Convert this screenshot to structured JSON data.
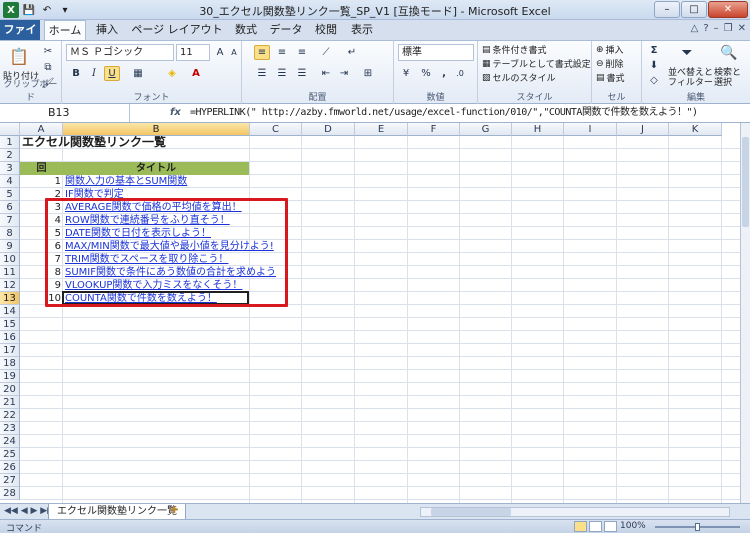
{
  "window": {
    "title": "30_エクセル関数塾リンク一覧_SP_V1 [互換モード] - Microsoft Excel",
    "minimize": "–",
    "maximize": "□",
    "close": "✕"
  },
  "qat": {
    "logo": "X",
    "save": "💾",
    "undo": "↶",
    "dropdown": "▾"
  },
  "tabs": [
    "ファイル",
    "ホーム",
    "挿入",
    "ページ レイアウト",
    "数式",
    "データ",
    "校閲",
    "表示"
  ],
  "tab_right": {
    "help": "?",
    "min": "–",
    "restore": "❐",
    "close": "✕",
    "collapse": "△"
  },
  "ribbon": {
    "clipboard": {
      "paste": "貼り付け",
      "label": "クリップボード"
    },
    "font": {
      "name": "ＭＳ Ｐゴシック",
      "size": "11",
      "bold": "B",
      "italic": "I",
      "underline": "U",
      "label": "フォント"
    },
    "alignment": {
      "label": "配置"
    },
    "number": {
      "format": "標準",
      "percent": "%",
      "comma": ",",
      "label": "数値"
    },
    "styles": {
      "conditional": "条件付き書式",
      "table": "テーブルとして書式設定",
      "cell": "セルのスタイル",
      "label": "スタイル"
    },
    "cells": {
      "insert": "挿入",
      "delete": "削除",
      "format": "書式",
      "label": "セル"
    },
    "editing": {
      "sum": "Σ",
      "sort": "並べ替えと",
      "sort2": "フィルター",
      "find": "検索と",
      "find2": "選択",
      "label": "編集"
    }
  },
  "formula_bar": {
    "name_box": "B13",
    "fx": "fx",
    "formula": "=HYPERLINK(\" http://azby.fmworld.net/usage/excel-function/010/\",\"COUNTA関数で件数を数えよう！\")"
  },
  "columns": [
    "A",
    "B",
    "C",
    "D",
    "E",
    "F",
    "G",
    "H",
    "I",
    "J",
    "K"
  ],
  "rows": [
    "1",
    "2",
    "3",
    "4",
    "5",
    "6",
    "7",
    "8",
    "9",
    "10",
    "11",
    "12",
    "13",
    "14",
    "15",
    "16",
    "17",
    "18",
    "19",
    "20",
    "21",
    "22",
    "23",
    "24",
    "25",
    "26",
    "27",
    "28"
  ],
  "sheet": {
    "title": "エクセル関数塾リンク一覧",
    "header_no": "回",
    "header_title": "タイトル",
    "items": [
      {
        "no": "1",
        "title": "関数入力の基本とSUM関数"
      },
      {
        "no": "2",
        "title": "IF関数で判定"
      },
      {
        "no": "3",
        "title": "AVERAGE関数で価格の平均値を算出！"
      },
      {
        "no": "4",
        "title": "ROW関数で連続番号をふり直そう！"
      },
      {
        "no": "5",
        "title": "DATE関数で日付を表示しよう！"
      },
      {
        "no": "6",
        "title": "MAX/MIN関数で最大値や最小値を見分けよう!"
      },
      {
        "no": "7",
        "title": "TRIM関数でスペースを取り除こう！"
      },
      {
        "no": "8",
        "title": "SUMIF関数で条件にあう数値の合計を求めよう"
      },
      {
        "no": "9",
        "title": "VLOOKUP関数で入力ミスをなくそう！"
      },
      {
        "no": "10",
        "title": "COUNTA関数で件数を数えよう！"
      }
    ]
  },
  "sheet_tabs": {
    "active": "エクセル関数塾リンク一覧",
    "nav": "◀◀ ◀ ▶ ▶▶"
  },
  "status": {
    "mode": "コマンド",
    "zoom": "100%",
    "minus": "⊖",
    "plus": "⊕"
  },
  "colors": {
    "accent": "#2b5f9e",
    "header_fill": "#9bbb59",
    "link": "#1a32d6",
    "highlight": "#d7191f"
  }
}
